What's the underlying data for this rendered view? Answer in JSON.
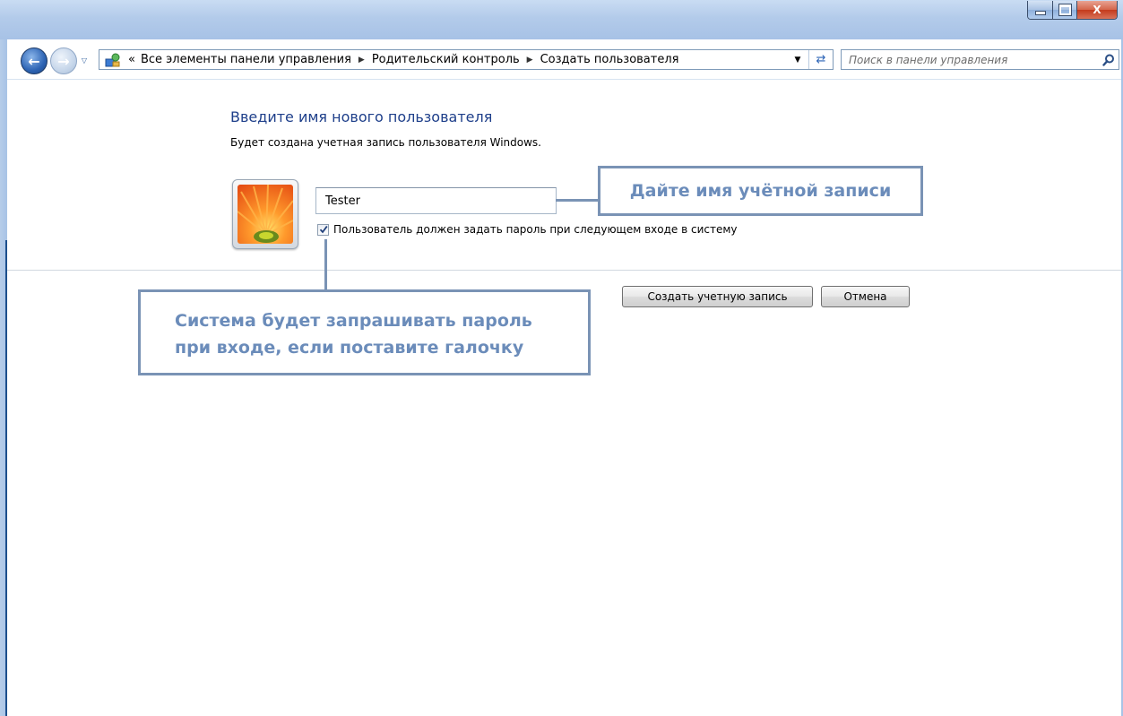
{
  "window": {
    "controls": {
      "close_glyph": "X"
    }
  },
  "navigation": {
    "breadcrumb_overflow": "«",
    "breadcrumbs": [
      "Все элементы панели управления",
      "Родительский контроль",
      "Создать пользователя"
    ],
    "search_placeholder": "Поиск в панели управления"
  },
  "content": {
    "title": "Введите имя нового пользователя",
    "subtitle": "Будет создана учетная запись пользователя Windows.",
    "username_value": "Tester",
    "password_option": {
      "label": "Пользователь должен задать пароль при следующем входе в систему",
      "checked": true
    },
    "buttons": {
      "create": "Создать учетную запись",
      "cancel": "Отмена"
    }
  },
  "annotations": {
    "account_name_hint": "Дайте имя учётной записи",
    "password_hint_line1": "Система будет запрашивать пароль",
    "password_hint_line2": "при входе, если поставите галочку"
  },
  "colors": {
    "title_blue": "#1e3f8a",
    "annotation_blue": "#6b8cba",
    "annotation_border": "#7a93b5",
    "titlebar": "#b3cbea",
    "close_red": "#c43a1c"
  }
}
